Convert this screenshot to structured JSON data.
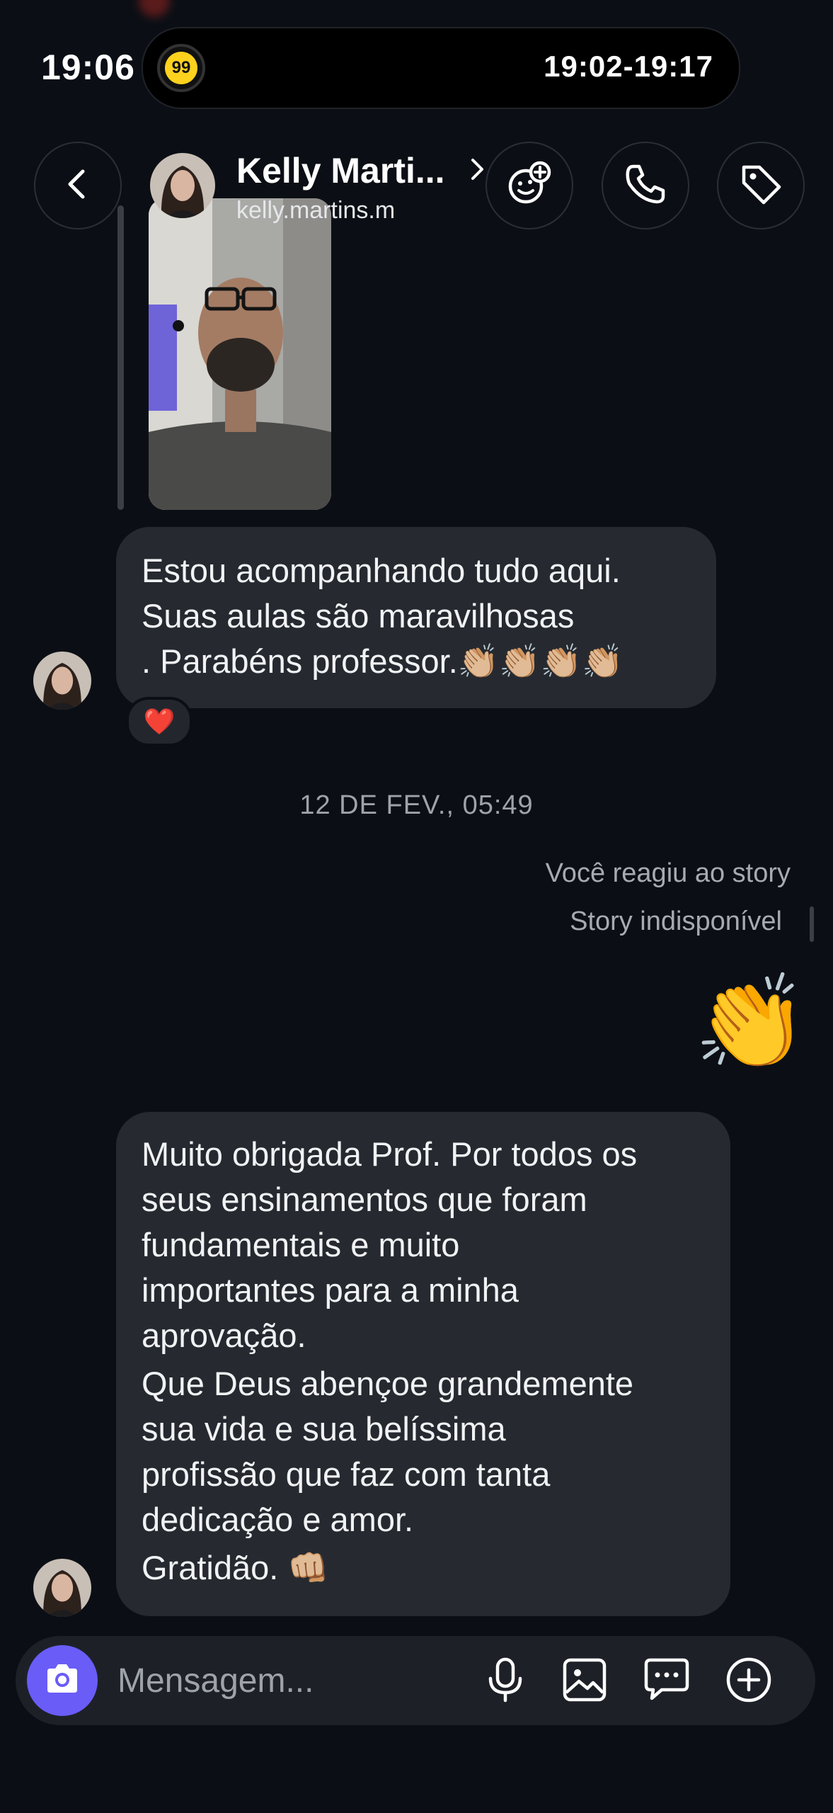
{
  "status_bar": {
    "time": "19:06",
    "live_activity_app": "99",
    "live_activity_time": "19:02-19:17"
  },
  "header": {
    "contact_name": "Kelly Marti...",
    "username": "kelly.martins.m"
  },
  "messages": {
    "first": {
      "lines": [
        "Estou acompanhando tudo aqui.",
        "Suas aulas são maravilhosas",
        ". Parabéns professor.👏🏼👏🏼👏🏼👏🏼"
      ],
      "reaction": "❤️"
    },
    "date_separator": "12 DE FEV., 05:49",
    "story_reaction_note": "Você reagiu ao story",
    "story_unavailable": "Story indisponível",
    "sent_emoji": "👏",
    "second": {
      "paragraph1": [
        "Muito obrigada Prof. Por todos os",
        "seus ensinamentos que foram",
        "fundamentais e muito",
        "importantes para a minha",
        "aprovação."
      ],
      "paragraph2": [
        "Que Deus abençoe grandemente",
        "sua vida e sua belíssima",
        "profissão que faz com tanta",
        "dedicação e amor."
      ],
      "closing": "Gratidão. 👊🏼"
    }
  },
  "composer": {
    "placeholder": "Mensagem..."
  },
  "colors": {
    "background": "#0b0f15",
    "bubble": "#262a30",
    "camera_button": "#6a5cf7",
    "muted_text": "#9ea3aa"
  }
}
